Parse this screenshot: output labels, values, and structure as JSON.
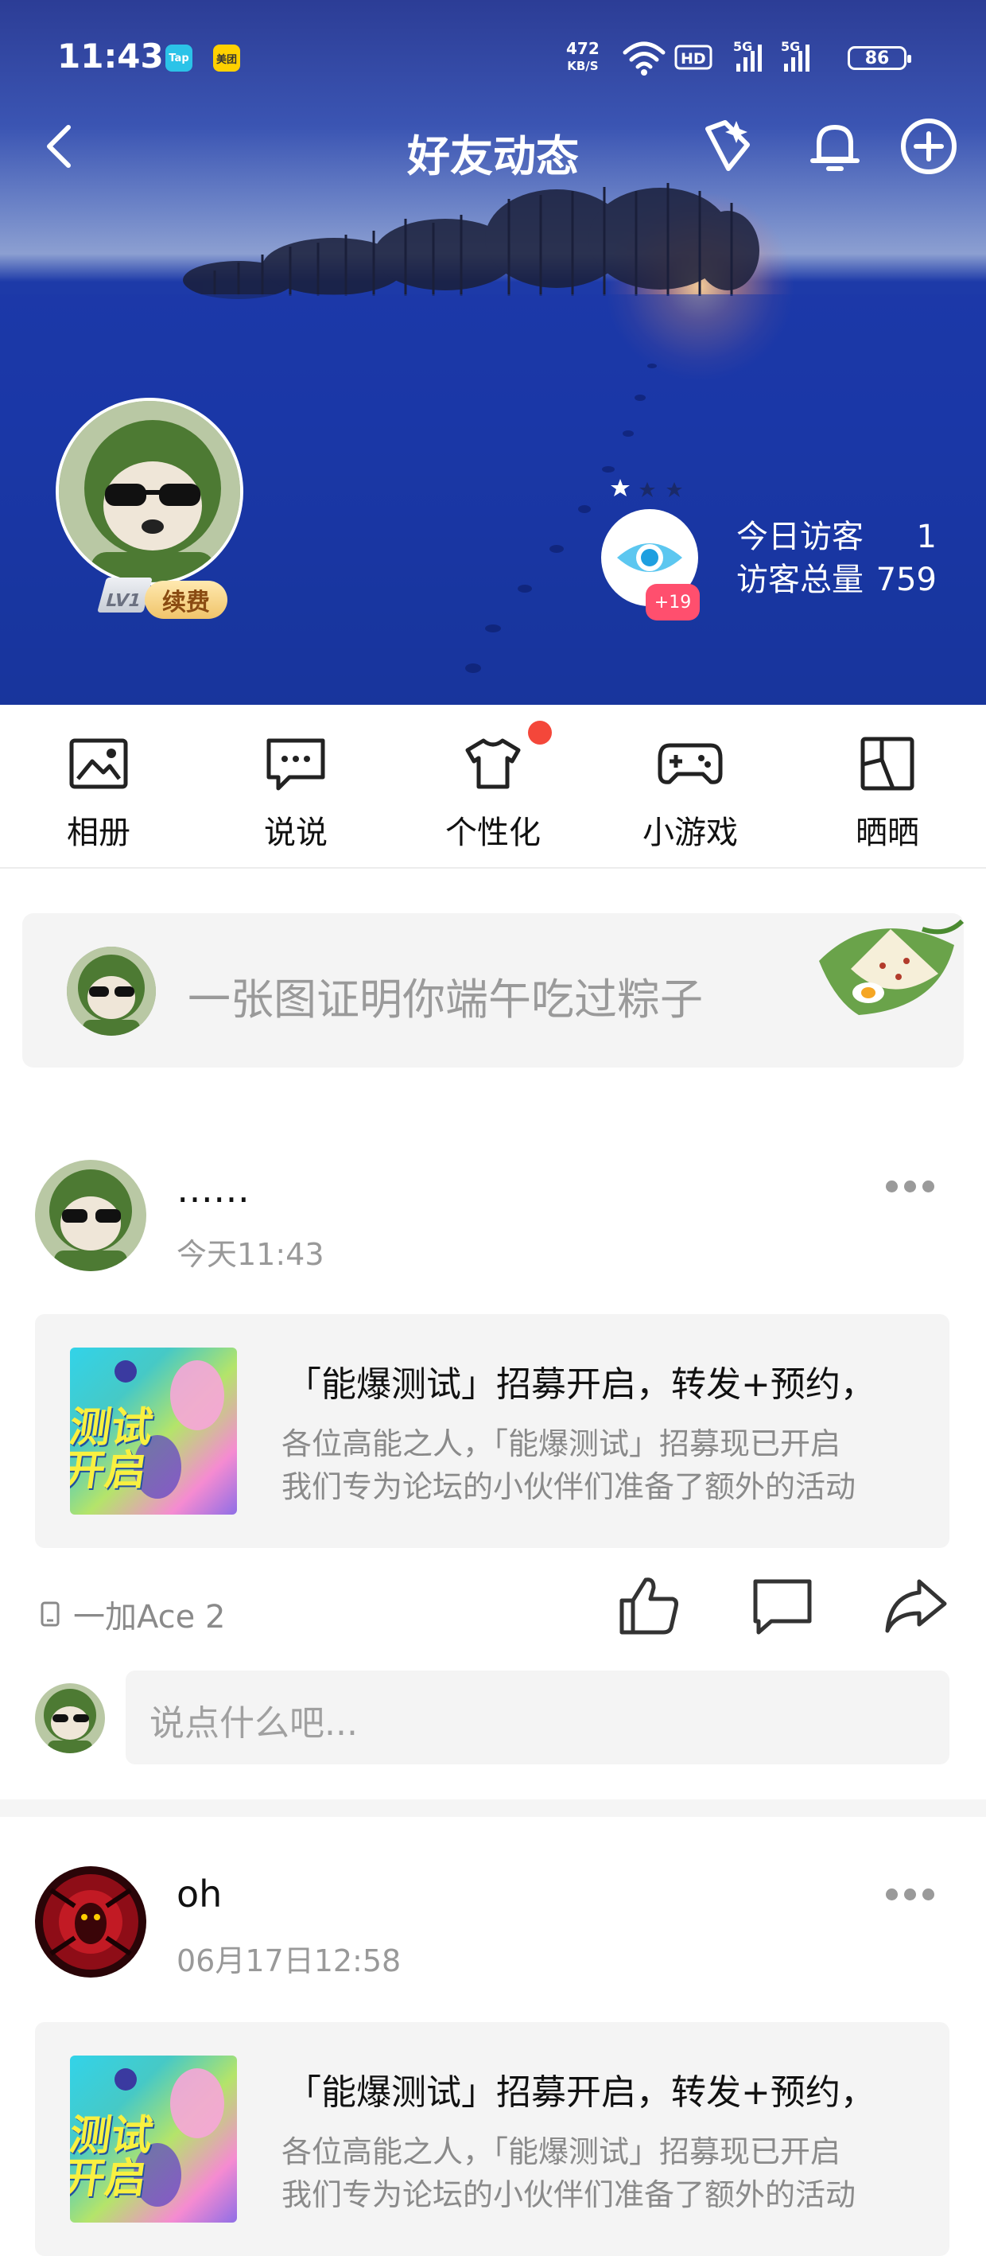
{
  "status_bar": {
    "time": "11:43",
    "app_badges": [
      "Tap",
      "美团"
    ],
    "net_speed_value": "472",
    "net_speed_unit": "KB/S",
    "hd_label": "HD",
    "signal_label_1": "5G",
    "signal_label_2": "5G",
    "battery": "86"
  },
  "nav": {
    "back_icon": "chevron-left-icon",
    "title": "好友动态",
    "icons": [
      "sparkle-diamond-icon",
      "bell-icon",
      "plus-circle-icon"
    ]
  },
  "profile": {
    "level": "LV1",
    "renew_label": "续费",
    "visitor_badge": "+19",
    "today_visitors_label": "今日访客",
    "today_visitors_value": "1",
    "total_visitors_label": "访客总量",
    "total_visitors_value": "759"
  },
  "shortcuts": [
    {
      "label": "相册",
      "icon": "photo-album-icon"
    },
    {
      "label": "说说",
      "icon": "chat-bubble-icon"
    },
    {
      "label": "个性化",
      "icon": "tshirt-icon",
      "has_red_dot": true
    },
    {
      "label": "小游戏",
      "icon": "gamepad-icon"
    },
    {
      "label": "晒晒",
      "icon": "grid-frame-icon"
    }
  ],
  "composer": {
    "placeholder": "一张图证明你端午吃过粽子"
  },
  "posts": [
    {
      "name": "……",
      "time": "今天11:43",
      "share_title": "「能爆测试」招募开启，转发+预约，",
      "share_desc_line1": "各位高能之人，「能爆测试」招募现已开启",
      "share_desc_line2": "我们专为论坛的小伙伴们准备了额外的活动",
      "thumb_text_1": "测试",
      "thumb_text_2": "开启",
      "device": "一加Ace 2",
      "comment_placeholder": "说点什么吧..."
    },
    {
      "name": "oh",
      "time": "06月17日12:58",
      "share_title": "「能爆测试」招募开启，转发+预约，",
      "share_desc_line1": "各位高能之人，「能爆测试」招募现已开启",
      "share_desc_line2": "我们专为论坛的小伙伴们准备了额外的活动",
      "thumb_text_1": "测试",
      "thumb_text_2": "开启"
    }
  ],
  "colors": {
    "accent_red": "#f4473a",
    "visitor_badge": "#ff4f6e",
    "renew_gold": "#f0c46a",
    "banner_blue": "#1a36a6"
  }
}
